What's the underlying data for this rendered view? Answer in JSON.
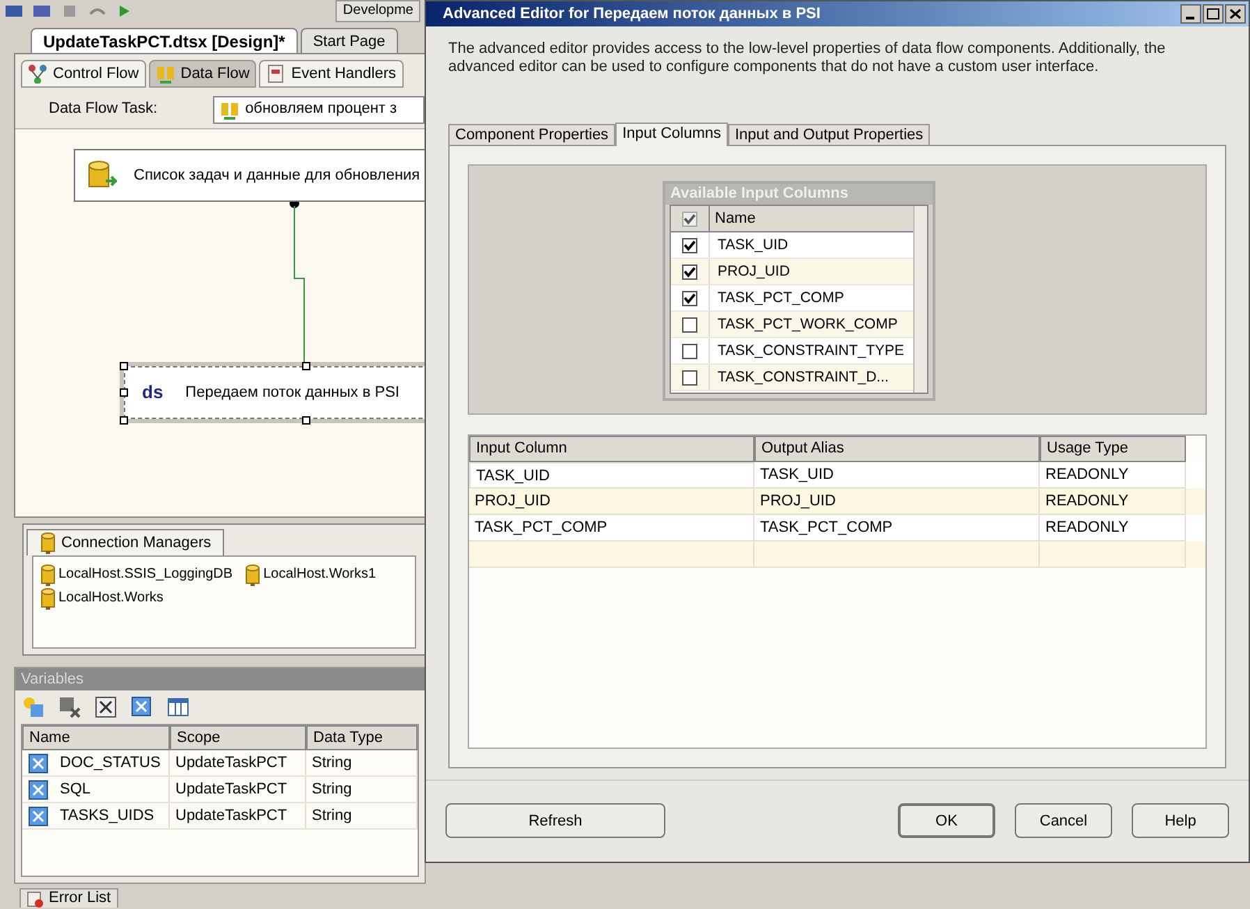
{
  "toolbar": {
    "label": "Developme"
  },
  "document_tabs": [
    {
      "label": "UpdateTaskPCT.dtsx [Design]*",
      "selected": true
    },
    {
      "label": "Start Page",
      "selected": false
    }
  ],
  "designer_tabs": [
    {
      "label": "Control Flow",
      "selected": false
    },
    {
      "label": "Data Flow",
      "selected": true
    },
    {
      "label": "Event Handlers",
      "selected": false
    }
  ],
  "data_flow_task": {
    "label": "Data Flow Task:",
    "value": "обновляем процент з"
  },
  "canvas": {
    "nodes": [
      {
        "kind": "source",
        "label": "Список задач и данные для обновления",
        "selected": false
      },
      {
        "kind": "destination",
        "icon_text": "ds",
        "label": "Передаем поток данных в PSI",
        "selected": true
      }
    ]
  },
  "connection_managers": {
    "title": "Connection Managers",
    "items": [
      "LocalHost.SSIS_LoggingDB",
      "LocalHost.Works1",
      "LocalHost.Works"
    ]
  },
  "variables": {
    "title": "Variables",
    "columns": [
      "Name",
      "Scope",
      "Data Type"
    ],
    "rows": [
      [
        "DOC_STATUS",
        "UpdateTaskPCT",
        "String"
      ],
      [
        "SQL",
        "UpdateTaskPCT",
        "String"
      ],
      [
        "TASKS_UIDS",
        "UpdateTaskPCT",
        "String"
      ]
    ]
  },
  "bottom_tabs": [
    {
      "label": "Error List"
    }
  ],
  "dialog": {
    "title": "Advanced Editor for Передаем поток данных в PSI",
    "description": "The advanced editor provides access to the low-level properties of data flow components. Additionally, the advanced editor can be used to configure components that do not have a custom user interface.",
    "tabs": [
      {
        "label": "Component Properties",
        "selected": false
      },
      {
        "label": "Input Columns",
        "selected": true
      },
      {
        "label": "Input and Output Properties",
        "selected": false
      }
    ],
    "available_columns": {
      "title": "Available Input Columns",
      "header": "Name",
      "header_checked": true,
      "rows": [
        {
          "name": "TASK_UID",
          "checked": true
        },
        {
          "name": "PROJ_UID",
          "checked": true
        },
        {
          "name": "TASK_PCT_COMP",
          "checked": true
        },
        {
          "name": "TASK_PCT_WORK_COMP",
          "checked": false
        },
        {
          "name": "TASK_CONSTRAINT_TYPE",
          "checked": false
        },
        {
          "name": "TASK_CONSTRAINT_D...",
          "checked": false
        }
      ]
    },
    "mapping": {
      "columns": [
        "Input Column",
        "Output Alias",
        "Usage Type"
      ],
      "rows": [
        [
          "TASK_UID",
          "TASK_UID",
          "READONLY"
        ],
        [
          "PROJ_UID",
          "PROJ_UID",
          "READONLY"
        ],
        [
          "TASK_PCT_COMP",
          "TASK_PCT_COMP",
          "READONLY"
        ]
      ]
    },
    "buttons": [
      "Refresh",
      "OK",
      "Cancel",
      "Help"
    ]
  }
}
